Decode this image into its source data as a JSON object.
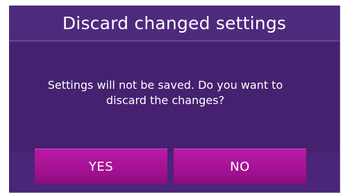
{
  "dialog": {
    "title": "Discard changed settings",
    "message": "Settings will not be saved. Do you want to discard the changes?",
    "yes_label": "YES",
    "no_label": "NO"
  },
  "colors": {
    "background": "#4a2578",
    "button": "#a0108f",
    "text": "#ffffff"
  }
}
